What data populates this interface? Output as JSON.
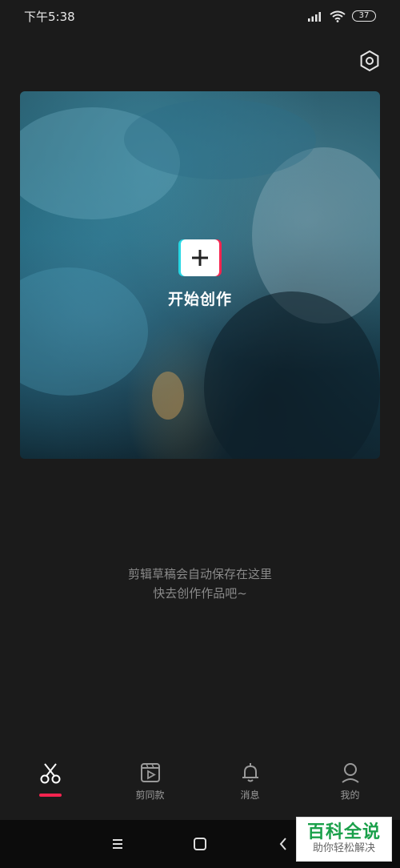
{
  "status": {
    "time": "下午5:38",
    "battery": "37"
  },
  "hero": {
    "create_label": "开始创作"
  },
  "hint": {
    "line1": "剪辑草稿会自动保存在这里",
    "line2": "快去创作作品吧~"
  },
  "tabs": [
    {
      "label": "",
      "icon": "scissors-icon",
      "active": true
    },
    {
      "label": "剪同款",
      "icon": "video-template-icon",
      "active": false
    },
    {
      "label": "消息",
      "icon": "bell-icon",
      "active": false
    },
    {
      "label": "我的",
      "icon": "profile-icon",
      "active": false
    }
  ],
  "watermark": {
    "title": "百科全说",
    "subtitle": "助你轻松解决"
  },
  "colors": {
    "accent": "#f5244f",
    "cyan": "#27d7e3",
    "background": "#1b1b1b"
  }
}
